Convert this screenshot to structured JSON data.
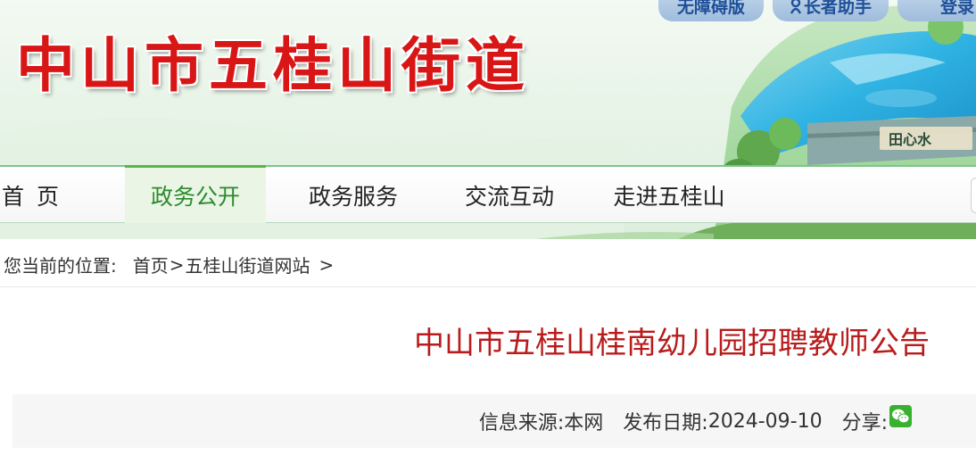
{
  "header": {
    "site_title": "中山市五桂山街道",
    "top_links": {
      "accessible": "无障碍版",
      "elder": "长者助手",
      "login": "登录"
    },
    "banner_sign_text": "田心水"
  },
  "nav": {
    "items": [
      {
        "label": "首页",
        "active": false
      },
      {
        "label": "政务公开",
        "active": true
      },
      {
        "label": "政务服务",
        "active": false
      },
      {
        "label": "交流互动",
        "active": false
      },
      {
        "label": "走进五桂山",
        "active": false
      }
    ]
  },
  "breadcrumb": {
    "label": "您当前的位置:",
    "home": "首页",
    "separator": ">",
    "site": "五桂山街道网站",
    "tail": ">"
  },
  "article": {
    "title": "中山市五桂山桂南幼儿园招聘教师公告",
    "source_label": "信息来源:",
    "source": "本网",
    "date_label": "发布日期:",
    "date": "2024-09-10",
    "share_label": "分享:",
    "share_icon": "wechat-icon"
  },
  "colors": {
    "title_red": "#d91616",
    "article_title_red": "#b81c1c",
    "nav_active_green": "#2d8a2d",
    "accent_green": "#5bb64a",
    "pill_blue": "#1e4f98"
  }
}
